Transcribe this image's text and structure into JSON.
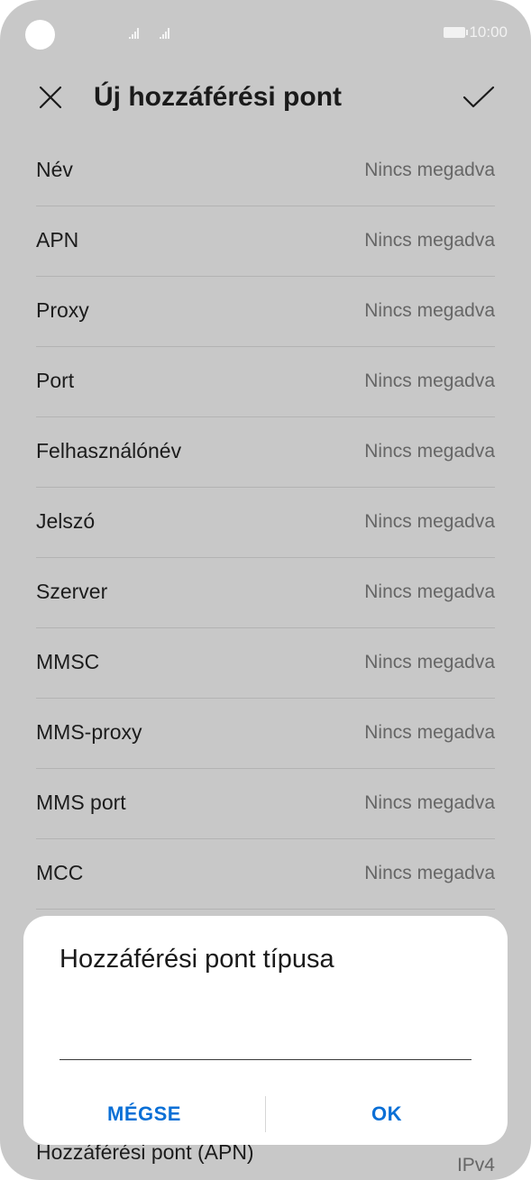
{
  "status_bar": {
    "time": "10:00"
  },
  "header": {
    "title": "Új hozzáférési pont",
    "close_icon": "close-icon",
    "confirm_icon": "checkmark-icon"
  },
  "settings": [
    {
      "label": "Név",
      "value": "Nincs megadva"
    },
    {
      "label": "APN",
      "value": "Nincs megadva"
    },
    {
      "label": "Proxy",
      "value": "Nincs megadva"
    },
    {
      "label": "Port",
      "value": "Nincs megadva"
    },
    {
      "label": "Felhasználónév",
      "value": "Nincs megadva"
    },
    {
      "label": "Jelszó",
      "value": "Nincs megadva"
    },
    {
      "label": "Szerver",
      "value": "Nincs megadva"
    },
    {
      "label": "MMSC",
      "value": "Nincs megadva"
    },
    {
      "label": "MMS-proxy",
      "value": "Nincs megadva"
    },
    {
      "label": "MMS port",
      "value": "Nincs megadva"
    },
    {
      "label": "MCC",
      "value": "Nincs megadva"
    }
  ],
  "behind_row": {
    "label": "Hozzáférési pont (APN)",
    "value": "IPv4"
  },
  "dialog": {
    "title": "Hozzáférési pont típusa",
    "input_value": "",
    "cancel_label": "MÉGSE",
    "ok_label": "OK"
  },
  "colors": {
    "accent": "#0a6fd6",
    "scrim_background": "#c8c8c8",
    "dialog_background": "#ffffff"
  }
}
